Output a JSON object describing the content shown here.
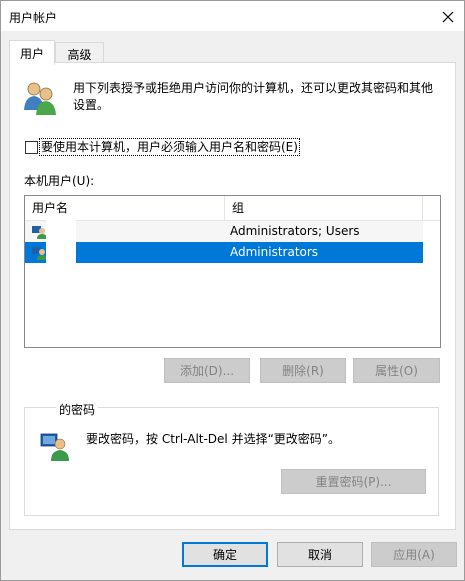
{
  "window": {
    "title": "用户帐户",
    "close_glyph": "✕"
  },
  "tabs": [
    {
      "label": "用户",
      "active": true
    },
    {
      "label": "高级",
      "active": false
    }
  ],
  "intro_text": "用下列表授予或拒绝用户访问你的计算机，还可以更改其密码和其他设置。",
  "require_login_checkbox": {
    "checked": false,
    "label": "要使用本计算机，用户必须输入用户名和密码(E)"
  },
  "users_list": {
    "label": "本机用户(U):",
    "columns": [
      "用户名",
      "组"
    ],
    "rows": [
      {
        "username": "",
        "group": "Administrators; Users",
        "selected": false,
        "icon": "user-account-icon"
      },
      {
        "username": "",
        "group": "Administrators",
        "selected": true,
        "icon": "user-account-icon"
      }
    ]
  },
  "list_buttons": {
    "add": "添加(D)...",
    "remove": "删除(R)",
    "properties": "属性(O)"
  },
  "password_group": {
    "title": "的密码",
    "text": "要改密码，按 Ctrl-Alt-Del 并选择“更改密码”。",
    "reset_button": "重置密码(P)..."
  },
  "dialog_buttons": {
    "ok": "确定",
    "cancel": "取消",
    "apply": "应用(A)"
  },
  "colors": {
    "selection": "#0078d7",
    "background": "#f0f0f0",
    "panel": "#ffffff"
  }
}
